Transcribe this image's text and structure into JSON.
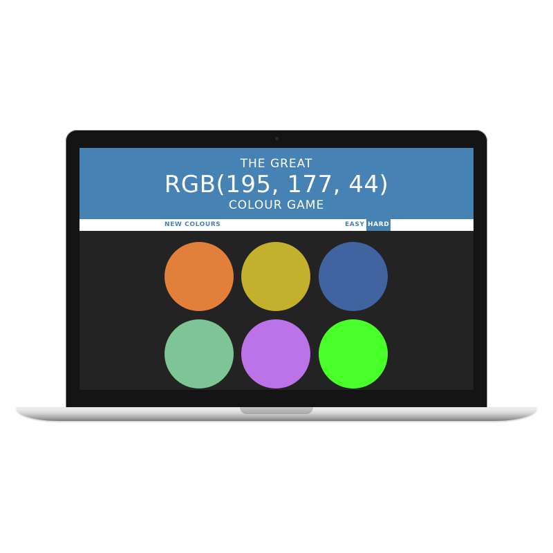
{
  "header": {
    "line1": "THE GREAT",
    "rgb_target": "RGB(195, 177, 44)",
    "line3": "COLOUR GAME"
  },
  "stripe": {
    "new_colours": "NEW COLOURS",
    "easy": "EASY",
    "hard": "HARD",
    "selected_mode": "HARD"
  },
  "colors": {
    "header_bg": "#4682b4",
    "board_bg": "#232323"
  },
  "squares": [
    {
      "color": "#e27f3c"
    },
    {
      "color": "#c3b02c"
    },
    {
      "color": "#4164a0"
    },
    {
      "color": "#7dc596"
    },
    {
      "color": "#bc72e9"
    },
    {
      "color": "#48ff2a"
    }
  ]
}
